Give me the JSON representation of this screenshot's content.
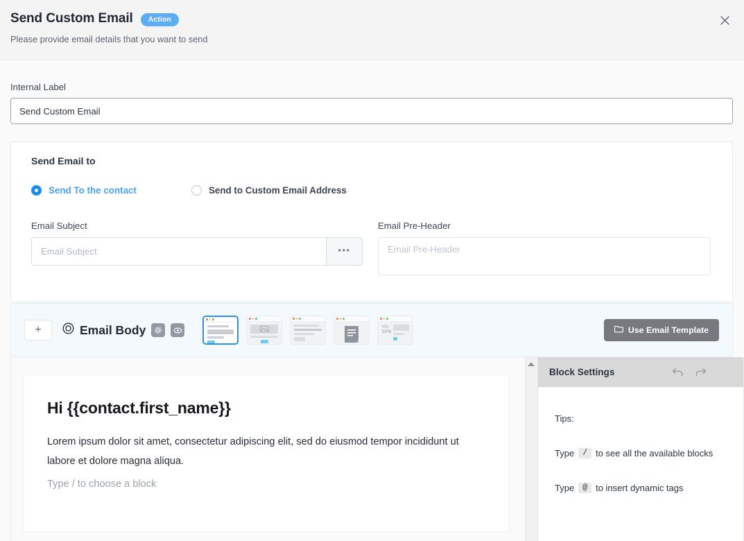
{
  "header": {
    "title": "Send Custom Email",
    "badge": "Action",
    "subtitle": "Please provide email details that you want to send",
    "close_icon": "close-icon"
  },
  "internal_label": {
    "label": "Internal Label",
    "value": "Send Custom Email"
  },
  "send_email_to": {
    "section_title": "Send Email to",
    "options": [
      {
        "label": "Send To the contact",
        "selected": true
      },
      {
        "label": "Send to Custom Email Address",
        "selected": false
      }
    ]
  },
  "email_subject": {
    "label": "Email Subject",
    "value": "",
    "placeholder": "Email Subject",
    "more_button": "•••"
  },
  "email_preheader": {
    "label": "Email Pre-Header",
    "value": "",
    "placeholder": "Email Pre-Header"
  },
  "email_body_toolbar": {
    "add_button": "+",
    "title": "Email Body",
    "title_icon": "target-circle-icon",
    "settings_icon": "gear-icon",
    "preview_icon": "eye-icon",
    "templates": [
      {
        "name": "text-and-button-template",
        "selected": true
      },
      {
        "name": "image-template",
        "selected": false
      },
      {
        "name": "text-list-template",
        "selected": false
      },
      {
        "name": "document-template",
        "selected": false
      },
      {
        "name": "code-template",
        "selected": false
      }
    ],
    "use_template_button": "Use Email Template",
    "use_template_icon": "folder-icon"
  },
  "editor": {
    "heading": "Hi {{contact.first_name}}",
    "paragraph": "Lorem ipsum dolor sit amet, consectetur adipiscing elit, sed do eiusmod tempor incididunt ut labore et dolore magna aliqua.",
    "placeholder": "Type / to choose a block"
  },
  "block_settings": {
    "title": "Block Settings",
    "undo_icon": "undo-arrow-icon",
    "redo_icon": "redo-arrow-icon",
    "tips_heading": "Tips:",
    "tips": [
      {
        "prefix": "Type",
        "key": "/",
        "suffix": "to see all the available blocks"
      },
      {
        "prefix": "Type",
        "key": "@",
        "suffix": "to insert dynamic tags"
      }
    ]
  },
  "colors": {
    "accent": "#1a8cf0",
    "badge": "#5cadf2",
    "toolbar_bg": "#f4f9fd",
    "button_gray": "#77797f",
    "panel_head": "#d9d9d9"
  }
}
